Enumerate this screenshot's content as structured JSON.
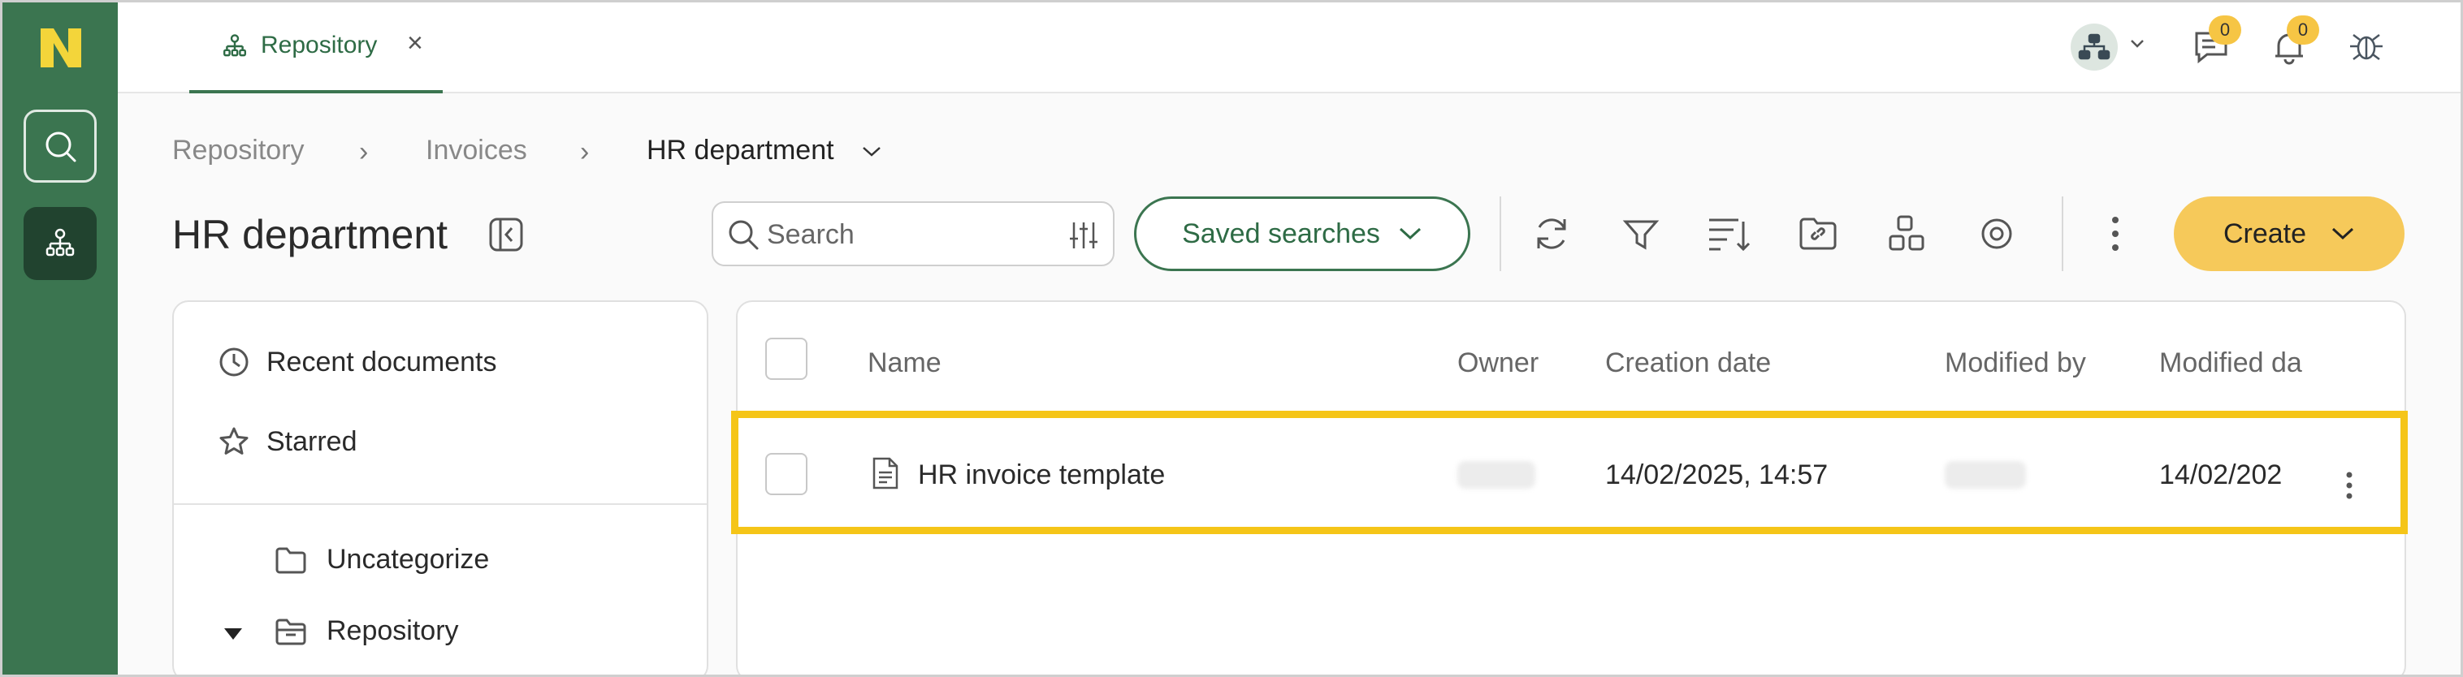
{
  "tab": {
    "label": "Repository",
    "close": "×"
  },
  "topbar": {
    "messages_count": "0",
    "notifications_count": "0"
  },
  "breadcrumb": {
    "items": [
      "Repository",
      "Invoices",
      "HR department"
    ],
    "separator": "›"
  },
  "page": {
    "title": "HR department"
  },
  "search": {
    "placeholder": "Search"
  },
  "toolbar": {
    "saved_searches_label": "Saved searches",
    "create_label": "Create"
  },
  "sidebar": {
    "quick": [
      "Recent documents",
      "Starred"
    ],
    "folders": [
      "Uncategorize",
      "Repository"
    ]
  },
  "table": {
    "columns": [
      "Name",
      "Owner",
      "Creation date",
      "Modified by",
      "Modified da"
    ],
    "rows": [
      {
        "name": "HR invoice template",
        "creation_date": "14/02/2025, 14:57",
        "modified_date": "14/02/202"
      }
    ]
  },
  "colors": {
    "brand_green": "#3b7550",
    "accent_yellow": "#f6c95a",
    "highlight": "#f5c518"
  }
}
